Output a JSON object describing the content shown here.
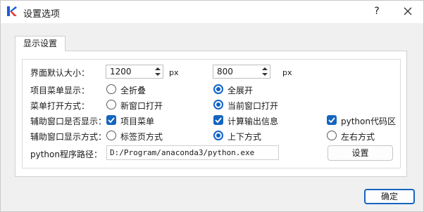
{
  "window": {
    "title": "设置选项",
    "help_glyph": "?"
  },
  "tab": {
    "label": "显示设置"
  },
  "rows": {
    "size": {
      "label": "界面默认大小：",
      "width_value": "1200",
      "width_unit": "px",
      "height_value": "800",
      "height_unit": "px"
    },
    "menu_display": {
      "label": "项目菜单显示：",
      "option_collapse": "全折叠",
      "option_expand": "全展开",
      "selected": "全展开"
    },
    "menu_open": {
      "label": "菜单打开方式：",
      "option_new_window": "新窗口打开",
      "option_current_window": "当前窗口打开",
      "selected": "当前窗口打开"
    },
    "aux_display": {
      "label": "辅助窗口是否显示：",
      "check_project_menu": "项目菜单",
      "check_calc_output": "计算输出信息",
      "check_python_code": "python代码区",
      "project_menu_checked": "true",
      "calc_output_checked": "true",
      "python_code_checked": "true"
    },
    "aux_mode": {
      "label": "辅助窗口显示方式：",
      "option_tabs": "标签页方式",
      "option_vertical": "上下方式",
      "option_horizontal": "左右方式",
      "selected": "上下方式"
    },
    "python_path": {
      "label": "python程序路径：",
      "value": "D:/Program/anaconda3/python.exe",
      "set_button": "设置"
    }
  },
  "footer": {
    "ok_button": "确定"
  },
  "colors": {
    "accent": "#1565c0",
    "logo_blue": "#1a5fd6",
    "logo_red": "#e53935"
  },
  "icons": [
    "app-logo-icon",
    "close-icon",
    "spin-arrows-icon",
    "checkmark-icon"
  ]
}
